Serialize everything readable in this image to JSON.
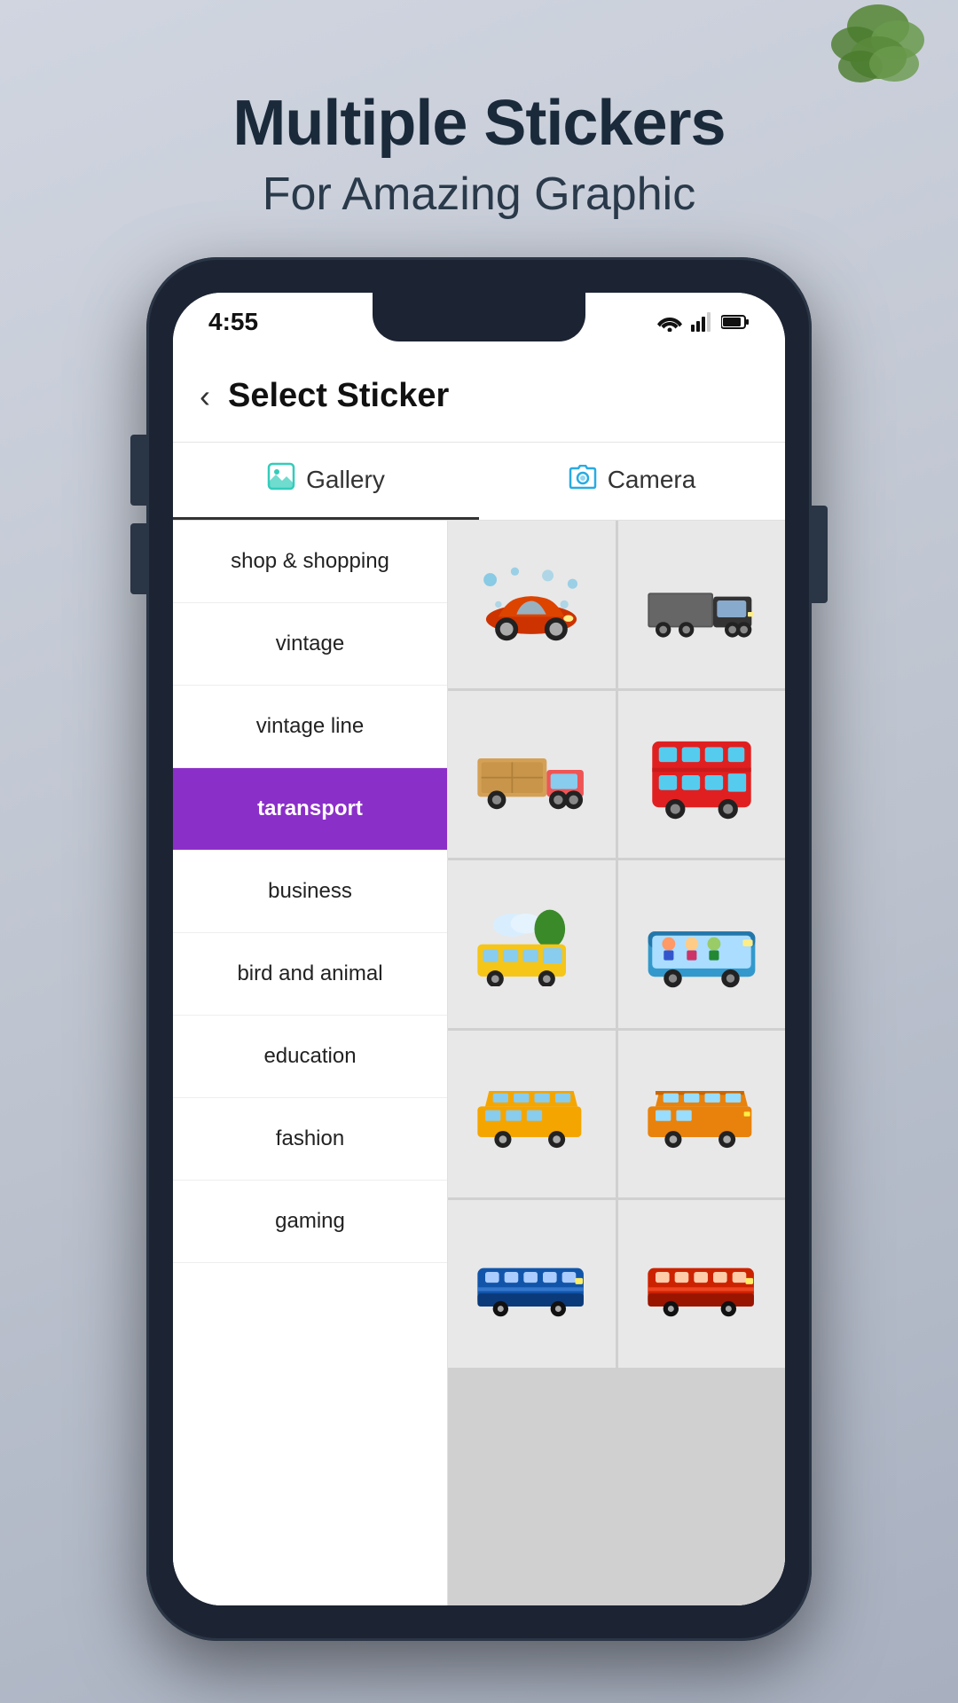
{
  "background": {
    "gradient_start": "#c8cdd8",
    "gradient_end": "#a8b0c0"
  },
  "header": {
    "title": "Multiple Stickers",
    "subtitle": "For Amazing Graphic"
  },
  "status_bar": {
    "time": "4:55",
    "icons": [
      "wifi",
      "signal",
      "battery"
    ]
  },
  "app": {
    "page_title": "Select Sticker",
    "back_label": "‹",
    "tabs": [
      {
        "id": "gallery",
        "label": "Gallery",
        "icon": "🖼"
      },
      {
        "id": "camera",
        "label": "Camera",
        "icon": "📷"
      }
    ],
    "categories": [
      {
        "id": "shop",
        "label": "shop & shopping",
        "active": false
      },
      {
        "id": "vintage",
        "label": "vintage",
        "active": false
      },
      {
        "id": "vintage_line",
        "label": "vintage line",
        "active": false
      },
      {
        "id": "taransport",
        "label": "taransport",
        "active": true
      },
      {
        "id": "business",
        "label": "business",
        "active": false
      },
      {
        "id": "bird_animal",
        "label": "bird and animal",
        "active": false
      },
      {
        "id": "education",
        "label": "education",
        "active": false
      },
      {
        "id": "fashion",
        "label": "fashion",
        "active": false
      },
      {
        "id": "gaming",
        "label": "gaming",
        "active": false
      }
    ],
    "stickers": [
      {
        "id": "car",
        "type": "sports_car"
      },
      {
        "id": "truck",
        "type": "semi_truck"
      },
      {
        "id": "delivery_truck",
        "type": "delivery_truck"
      },
      {
        "id": "red_bus",
        "type": "double_decker_bus"
      },
      {
        "id": "school_bus",
        "type": "school_bus_tree"
      },
      {
        "id": "people_bus",
        "type": "bus_people"
      },
      {
        "id": "minivan_blue",
        "type": "minivan_blue"
      },
      {
        "id": "minivan_orange",
        "type": "minivan_orange"
      },
      {
        "id": "bus_blue",
        "type": "bus_blue_long"
      },
      {
        "id": "bus_red",
        "type": "bus_red_long"
      }
    ]
  }
}
